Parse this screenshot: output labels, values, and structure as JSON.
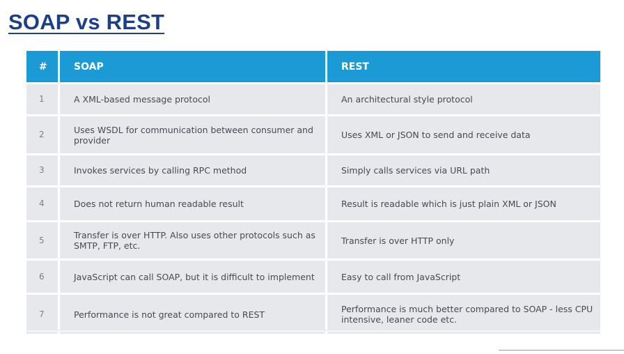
{
  "title": "SOAP vs REST",
  "table": {
    "headers": [
      "#",
      "SOAP",
      "REST"
    ],
    "rows": [
      {
        "num": "1",
        "soap": "A XML-based message protocol",
        "rest": "An architectural style protocol"
      },
      {
        "num": "2",
        "soap": "Uses WSDL for communication between consumer and provider",
        "rest": "Uses XML or JSON to send and receive data"
      },
      {
        "num": "3",
        "soap": "Invokes services by calling RPC method",
        "rest": "Simply calls services via URL path"
      },
      {
        "num": "4",
        "soap": "Does not return human readable result",
        "rest": "Result is readable which is just plain XML or JSON"
      },
      {
        "num": "5",
        "soap": "Transfer is over HTTP. Also uses other protocols such as SMTP, FTP, etc.",
        "rest": "Transfer is over HTTP only"
      },
      {
        "num": "6",
        "soap": "JavaScript can call SOAP, but it is difficult to implement",
        "rest": "Easy to call from JavaScript"
      },
      {
        "num": "7",
        "soap": "Performance is not great compared to REST",
        "rest": "Performance is much better compared to SOAP - less CPU intensive, leaner code etc."
      }
    ]
  },
  "colors": {
    "title": "#1c3f8a",
    "header_bg": "#1b9ad6",
    "row_bg": "#e7e8ec",
    "row_text": "#454a52"
  }
}
